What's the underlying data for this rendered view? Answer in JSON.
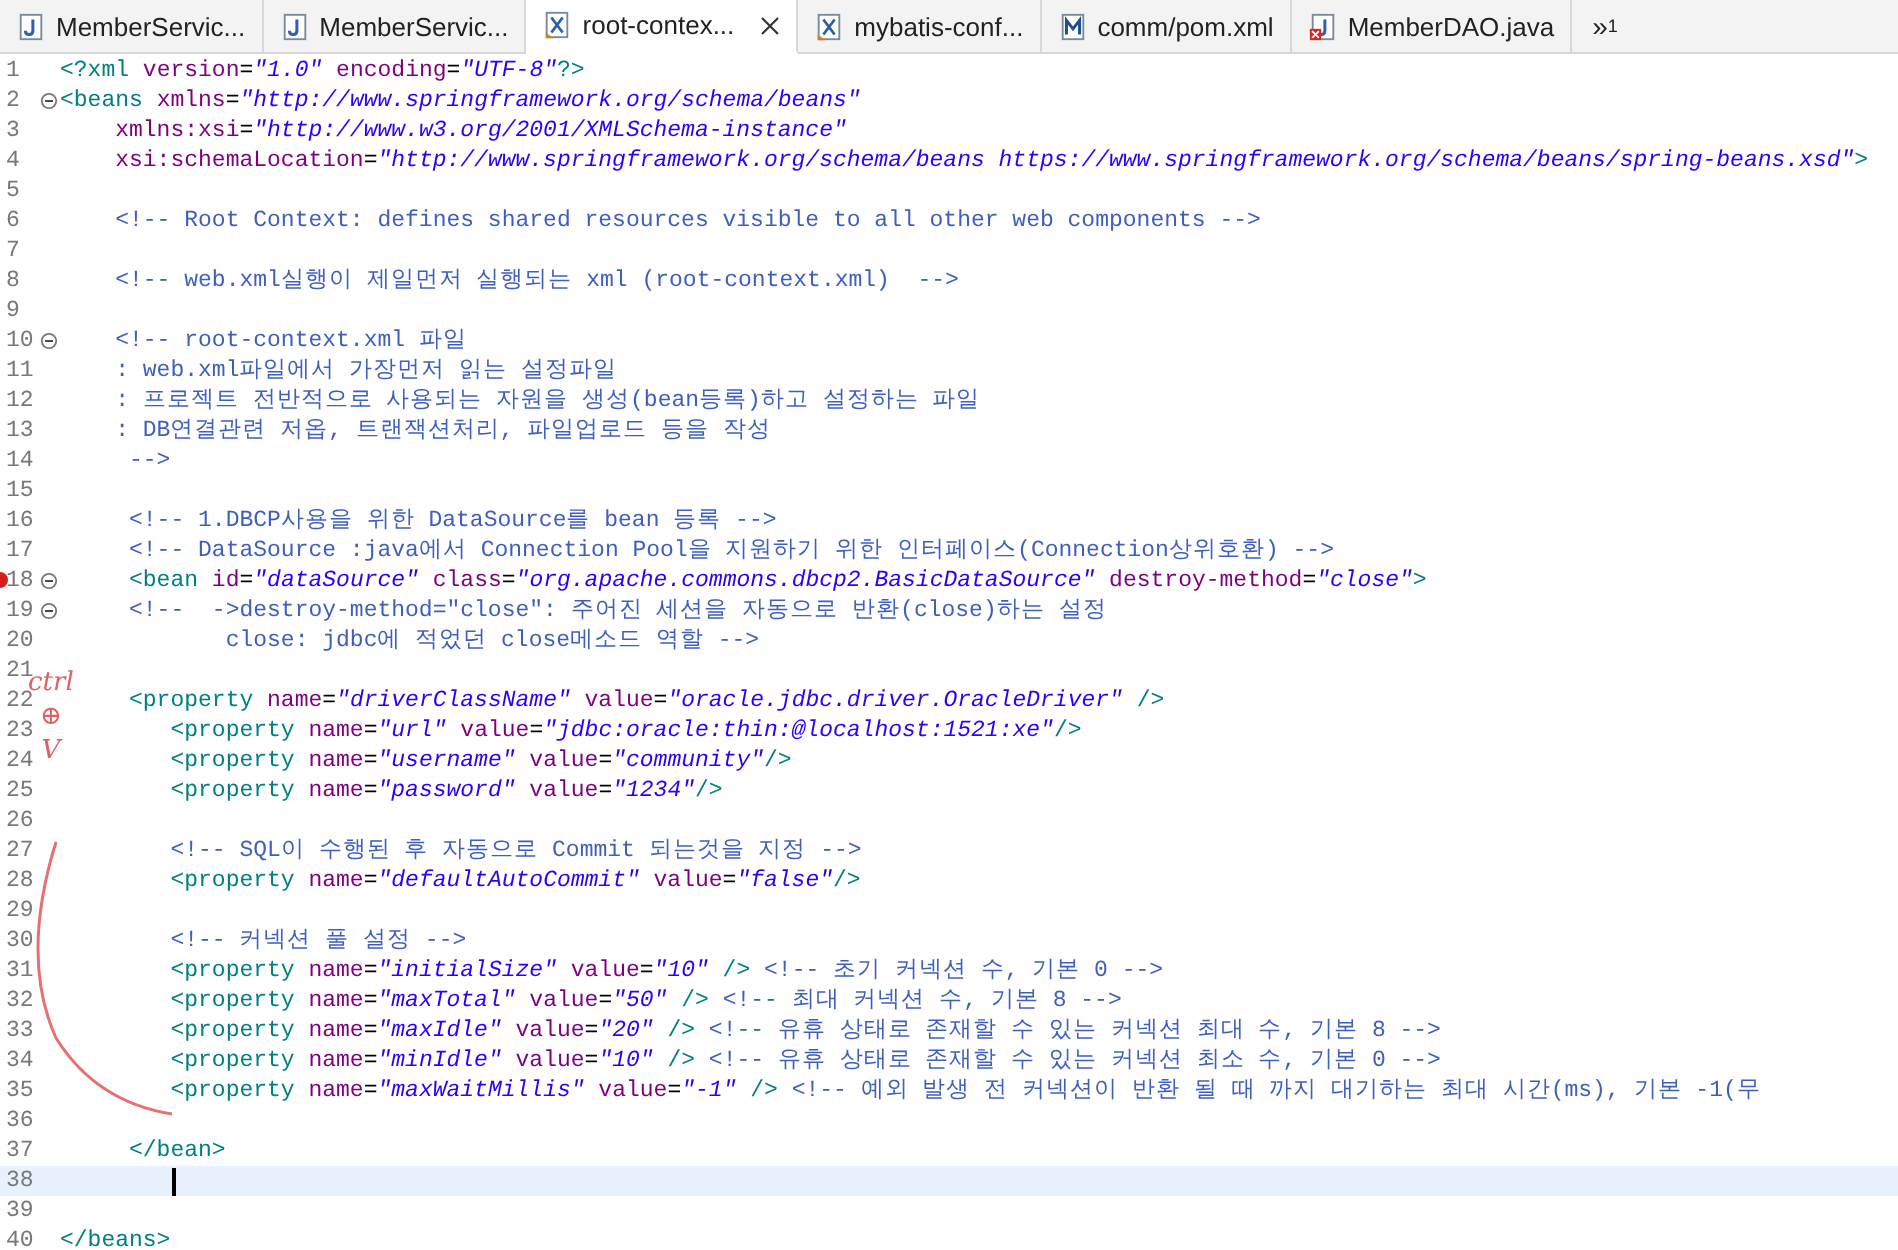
{
  "tabs": [
    {
      "label": "MemberServic...",
      "kind": "java",
      "selected": false,
      "error": false
    },
    {
      "label": "MemberServic...",
      "kind": "java",
      "selected": false,
      "error": false
    },
    {
      "label": "root-contex...",
      "kind": "xml",
      "selected": true,
      "error": false
    },
    {
      "label": "mybatis-conf...",
      "kind": "xml",
      "selected": false,
      "error": false
    },
    {
      "label": "comm/pom.xml",
      "kind": "maven",
      "selected": false,
      "error": false
    },
    {
      "label": "MemberDAO.java",
      "kind": "java",
      "selected": false,
      "error": true
    }
  ],
  "tab_overflow": {
    "chevron": "»",
    "count": "1"
  },
  "editor": {
    "lines": [
      {
        "number": "1",
        "fold": false,
        "error": false,
        "current": false,
        "tokens": [
          {
            "kind": "tag",
            "text": "<?xml"
          },
          {
            "kind": "attr",
            "text": " version"
          },
          {
            "kind": "plain",
            "text": "="
          },
          {
            "kind": "value",
            "text": "\"1.0\""
          },
          {
            "kind": "attr",
            "text": " encoding"
          },
          {
            "kind": "plain",
            "text": "="
          },
          {
            "kind": "value",
            "text": "\"UTF-8\""
          },
          {
            "kind": "tag",
            "text": "?>"
          }
        ]
      },
      {
        "number": "2",
        "fold": true,
        "error": false,
        "current": false,
        "tokens": [
          {
            "kind": "tag",
            "text": "<beans"
          },
          {
            "kind": "attr",
            "text": " xmlns"
          },
          {
            "kind": "plain",
            "text": "="
          },
          {
            "kind": "value",
            "text": "\"http://www.springframework.org/schema/beans\""
          }
        ]
      },
      {
        "number": "3",
        "fold": false,
        "error": false,
        "current": false,
        "tokens": [
          {
            "kind": "attr",
            "text": "    xmlns:xsi"
          },
          {
            "kind": "plain",
            "text": "="
          },
          {
            "kind": "value",
            "text": "\"http://www.w3.org/2001/XMLSchema-instance\""
          }
        ]
      },
      {
        "number": "4",
        "fold": false,
        "error": false,
        "current": false,
        "tokens": [
          {
            "kind": "attr",
            "text": "    xsi:schemaLocation"
          },
          {
            "kind": "plain",
            "text": "="
          },
          {
            "kind": "value",
            "text": "\"http://www.springframework.org/schema/beans https://www.springframework.org/schema/beans/spring-beans.xsd\""
          },
          {
            "kind": "tag",
            "text": ">"
          }
        ]
      },
      {
        "number": "5",
        "fold": false,
        "error": false,
        "current": false
      },
      {
        "number": "6",
        "fold": false,
        "error": false,
        "current": false,
        "tokens": [
          {
            "kind": "comment",
            "text": "    <!-- Root Context: defines shared resources visible to all other web components -->"
          }
        ]
      },
      {
        "number": "7",
        "fold": false,
        "error": false,
        "current": false
      },
      {
        "number": "8",
        "fold": false,
        "error": false,
        "current": false,
        "tokens": [
          {
            "kind": "comment",
            "text": "    <!-- web.xml실행이 제일먼저 실행되는 xml (root-context.xml)  -->"
          }
        ]
      },
      {
        "number": "9",
        "fold": false,
        "error": false,
        "current": false
      },
      {
        "number": "10",
        "fold": true,
        "error": false,
        "current": false,
        "tokens": [
          {
            "kind": "comment",
            "text": "    <!-- root-context.xml 파일"
          }
        ]
      },
      {
        "number": "11",
        "fold": false,
        "error": false,
        "current": false,
        "tokens": [
          {
            "kind": "comment",
            "text": "    : web.xml파일에서 가장먼저 읽는 설정파일"
          }
        ]
      },
      {
        "number": "12",
        "fold": false,
        "error": false,
        "current": false,
        "tokens": [
          {
            "kind": "comment",
            "text": "    : 프로젝트 전반적으로 사용되는 자원을 생성(bean등록)하고 설정하는 파일"
          }
        ]
      },
      {
        "number": "13",
        "fold": false,
        "error": false,
        "current": false,
        "tokens": [
          {
            "kind": "comment",
            "text": "    : DB연결관련 저옵, 트랜잭션처리, 파일업로드 등을 작성"
          }
        ]
      },
      {
        "number": "14",
        "fold": false,
        "error": false,
        "current": false,
        "tokens": [
          {
            "kind": "comment",
            "text": "     -->"
          }
        ]
      },
      {
        "number": "15",
        "fold": false,
        "error": false,
        "current": false
      },
      {
        "number": "16",
        "fold": false,
        "error": false,
        "current": false,
        "tokens": [
          {
            "kind": "comment",
            "text": "     <!-- 1.DBCP사용을 위한 DataSource를 bean 등록 -->"
          }
        ]
      },
      {
        "number": "17",
        "fold": false,
        "error": false,
        "current": false,
        "tokens": [
          {
            "kind": "comment",
            "text": "     <!-- DataSource :java에서 Connection Pool을 지원하기 위한 인터페이스(Connection상위호환) -->"
          }
        ]
      },
      {
        "number": "18",
        "fold": true,
        "error": true,
        "current": false,
        "tokens": [
          {
            "kind": "tag",
            "text": "     <bean"
          },
          {
            "kind": "attr",
            "text": " id"
          },
          {
            "kind": "plain",
            "text": "="
          },
          {
            "kind": "value",
            "text": "\"dataSource\""
          },
          {
            "kind": "attr",
            "text": " class"
          },
          {
            "kind": "plain",
            "text": "="
          },
          {
            "kind": "value",
            "text": "\"org.apache.commons.dbcp2.BasicDataSource\""
          },
          {
            "kind": "attr",
            "text": " destroy-method"
          },
          {
            "kind": "plain",
            "text": "="
          },
          {
            "kind": "value",
            "text": "\"close\""
          },
          {
            "kind": "tag",
            "text": ">"
          }
        ]
      },
      {
        "number": "19",
        "fold": true,
        "error": false,
        "current": false,
        "tokens": [
          {
            "kind": "comment",
            "text": "     <!--  ->destroy-method=\"close\": 주어진 세션을 자동으로 반환(close)하는 설정"
          }
        ]
      },
      {
        "number": "20",
        "fold": false,
        "error": false,
        "current": false,
        "tokens": [
          {
            "kind": "comment",
            "text": "            close: jdbc에 적었던 close메소드 역할 -->"
          }
        ]
      },
      {
        "number": "21",
        "fold": false,
        "error": false,
        "current": false
      },
      {
        "number": "22",
        "fold": false,
        "error": false,
        "current": false,
        "tokens": [
          {
            "kind": "tag",
            "text": "     <property"
          },
          {
            "kind": "attr",
            "text": " name"
          },
          {
            "kind": "plain",
            "text": "="
          },
          {
            "kind": "value",
            "text": "\"driverClassName\""
          },
          {
            "kind": "attr",
            "text": " value"
          },
          {
            "kind": "plain",
            "text": "="
          },
          {
            "kind": "value",
            "text": "\"oracle.jdbc.driver.OracleDriver\""
          },
          {
            "kind": "tag",
            "text": " />"
          }
        ]
      },
      {
        "number": "23",
        "fold": false,
        "error": false,
        "current": false,
        "tokens": [
          {
            "kind": "tag",
            "text": "        <property"
          },
          {
            "kind": "attr",
            "text": " name"
          },
          {
            "kind": "plain",
            "text": "="
          },
          {
            "kind": "value",
            "text": "\"url\""
          },
          {
            "kind": "attr",
            "text": " value"
          },
          {
            "kind": "plain",
            "text": "="
          },
          {
            "kind": "value",
            "text": "\"jdbc:oracle:thin:@localhost:1521:xe\""
          },
          {
            "kind": "tag",
            "text": "/>"
          }
        ]
      },
      {
        "number": "24",
        "fold": false,
        "error": false,
        "current": false,
        "tokens": [
          {
            "kind": "tag",
            "text": "        <property"
          },
          {
            "kind": "attr",
            "text": " name"
          },
          {
            "kind": "plain",
            "text": "="
          },
          {
            "kind": "value",
            "text": "\"username\""
          },
          {
            "kind": "attr",
            "text": " value"
          },
          {
            "kind": "plain",
            "text": "="
          },
          {
            "kind": "value",
            "text": "\"community\""
          },
          {
            "kind": "tag",
            "text": "/>"
          }
        ]
      },
      {
        "number": "25",
        "fold": false,
        "error": false,
        "current": false,
        "tokens": [
          {
            "kind": "tag",
            "text": "        <property"
          },
          {
            "kind": "attr",
            "text": " name"
          },
          {
            "kind": "plain",
            "text": "="
          },
          {
            "kind": "value",
            "text": "\"password\""
          },
          {
            "kind": "attr",
            "text": " value"
          },
          {
            "kind": "plain",
            "text": "="
          },
          {
            "kind": "value",
            "text": "\"1234\""
          },
          {
            "kind": "tag",
            "text": "/>"
          }
        ]
      },
      {
        "number": "26",
        "fold": false,
        "error": false,
        "current": false
      },
      {
        "number": "27",
        "fold": false,
        "error": false,
        "current": false,
        "tokens": [
          {
            "kind": "comment",
            "text": "        <!-- SQL이 수행된 후 자동으로 Commit 되는것을 지정 -->"
          }
        ]
      },
      {
        "number": "28",
        "fold": false,
        "error": false,
        "current": false,
        "tokens": [
          {
            "kind": "tag",
            "text": "        <property"
          },
          {
            "kind": "attr",
            "text": " name"
          },
          {
            "kind": "plain",
            "text": "="
          },
          {
            "kind": "value",
            "text": "\"defaultAutoCommit\""
          },
          {
            "kind": "attr",
            "text": " value"
          },
          {
            "kind": "plain",
            "text": "="
          },
          {
            "kind": "value",
            "text": "\"false\""
          },
          {
            "kind": "tag",
            "text": "/>"
          }
        ]
      },
      {
        "number": "29",
        "fold": false,
        "error": false,
        "current": false
      },
      {
        "number": "30",
        "fold": false,
        "error": false,
        "current": false,
        "tokens": [
          {
            "kind": "comment",
            "text": "        <!-- 커넥션 풀 설정 -->"
          }
        ]
      },
      {
        "number": "31",
        "fold": false,
        "error": false,
        "current": false,
        "tokens": [
          {
            "kind": "tag",
            "text": "        <property"
          },
          {
            "kind": "attr",
            "text": " name"
          },
          {
            "kind": "plain",
            "text": "="
          },
          {
            "kind": "value",
            "text": "\"initialSize\""
          },
          {
            "kind": "attr",
            "text": " value"
          },
          {
            "kind": "plain",
            "text": "="
          },
          {
            "kind": "value",
            "text": "\"10\""
          },
          {
            "kind": "tag",
            "text": " />"
          },
          {
            "kind": "comment",
            "text": " <!-- 초기 커넥션 수, 기본 0 -->"
          }
        ]
      },
      {
        "number": "32",
        "fold": false,
        "error": false,
        "current": false,
        "tokens": [
          {
            "kind": "tag",
            "text": "        <property"
          },
          {
            "kind": "attr",
            "text": " name"
          },
          {
            "kind": "plain",
            "text": "="
          },
          {
            "kind": "value",
            "text": "\"maxTotal\""
          },
          {
            "kind": "attr",
            "text": " value"
          },
          {
            "kind": "plain",
            "text": "="
          },
          {
            "kind": "value",
            "text": "\"50\""
          },
          {
            "kind": "tag",
            "text": " />"
          },
          {
            "kind": "comment",
            "text": " <!-- 최대 커넥션 수, 기본 8 -->"
          }
        ]
      },
      {
        "number": "33",
        "fold": false,
        "error": false,
        "current": false,
        "tokens": [
          {
            "kind": "tag",
            "text": "        <property"
          },
          {
            "kind": "attr",
            "text": " name"
          },
          {
            "kind": "plain",
            "text": "="
          },
          {
            "kind": "value",
            "text": "\"maxIdle\""
          },
          {
            "kind": "attr",
            "text": " value"
          },
          {
            "kind": "plain",
            "text": "="
          },
          {
            "kind": "value",
            "text": "\"20\""
          },
          {
            "kind": "tag",
            "text": " />"
          },
          {
            "kind": "comment",
            "text": " <!-- 유휴 상태로 존재할 수 있는 커넥션 최대 수, 기본 8 -->"
          }
        ]
      },
      {
        "number": "34",
        "fold": false,
        "error": false,
        "current": false,
        "tokens": [
          {
            "kind": "tag",
            "text": "        <property"
          },
          {
            "kind": "attr",
            "text": " name"
          },
          {
            "kind": "plain",
            "text": "="
          },
          {
            "kind": "value",
            "text": "\"minIdle\""
          },
          {
            "kind": "attr",
            "text": " value"
          },
          {
            "kind": "plain",
            "text": "="
          },
          {
            "kind": "value",
            "text": "\"10\""
          },
          {
            "kind": "tag",
            "text": " />"
          },
          {
            "kind": "comment",
            "text": " <!-- 유휴 상태로 존재할 수 있는 커넥션 최소 수, 기본 0 -->"
          }
        ]
      },
      {
        "number": "35",
        "fold": false,
        "error": false,
        "current": false,
        "tokens": [
          {
            "kind": "tag",
            "text": "        <property"
          },
          {
            "kind": "attr",
            "text": " name"
          },
          {
            "kind": "plain",
            "text": "="
          },
          {
            "kind": "value",
            "text": "\"maxWaitMillis\""
          },
          {
            "kind": "attr",
            "text": " value"
          },
          {
            "kind": "plain",
            "text": "="
          },
          {
            "kind": "value",
            "text": "\"-1\""
          },
          {
            "kind": "tag",
            "text": " />"
          },
          {
            "kind": "comment",
            "text": " <!-- 예외 발생 전 커넥션이 반환 될 때 까지 대기하는 최대 시간(ms), 기본 -1(무"
          }
        ]
      },
      {
        "number": "36",
        "fold": false,
        "error": false,
        "current": false
      },
      {
        "number": "37",
        "fold": false,
        "error": false,
        "current": false,
        "tokens": [
          {
            "kind": "tag",
            "text": "     </bean>"
          }
        ]
      },
      {
        "number": "38",
        "fold": false,
        "error": false,
        "current": true
      },
      {
        "number": "39",
        "fold": false,
        "error": false,
        "current": false
      },
      {
        "number": "40",
        "fold": false,
        "error": false,
        "current": false,
        "tokens": [
          {
            "kind": "tag",
            "text": "</beans>"
          }
        ]
      }
    ]
  },
  "annotation": {
    "texts": [
      "ctrl",
      "⊕",
      "V"
    ]
  }
}
